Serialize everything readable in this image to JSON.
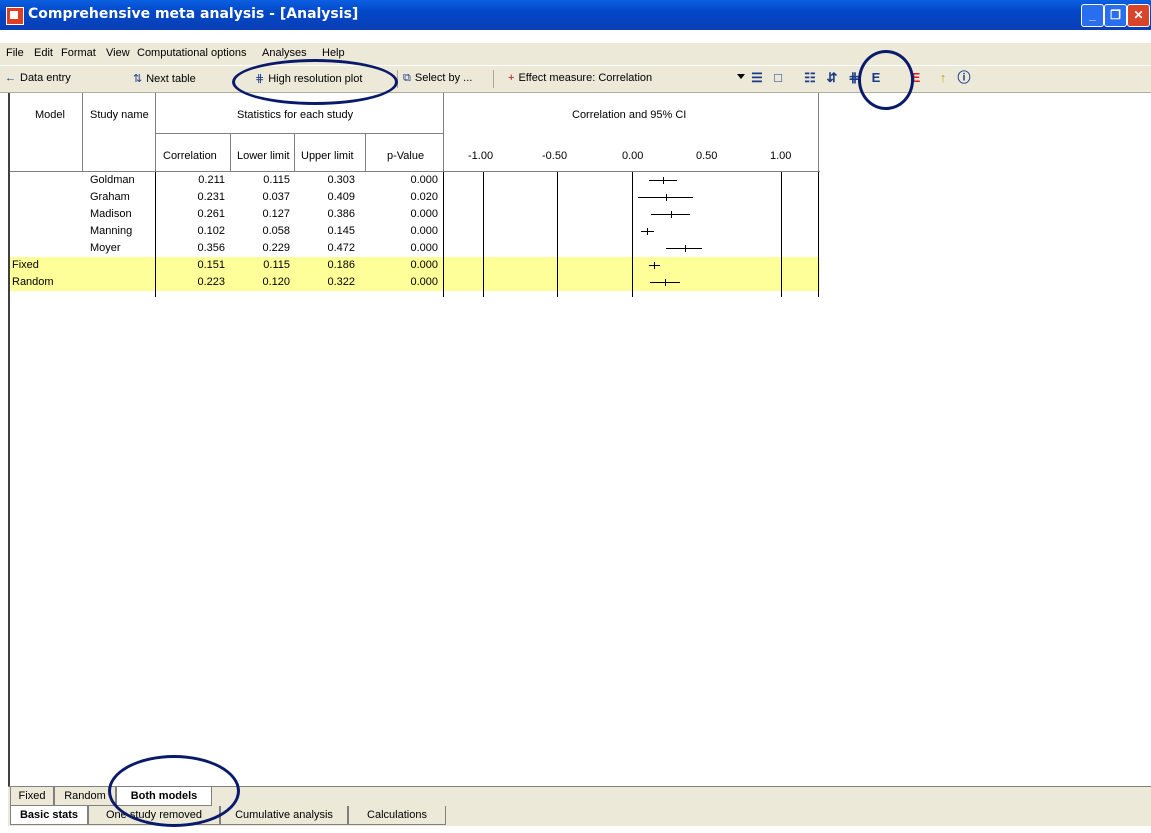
{
  "window": {
    "title": "Comprehensive meta analysis - [Analysis]"
  },
  "menu": [
    "File",
    "Edit",
    "Format",
    "View",
    "Computational options",
    "Analyses",
    "Help"
  ],
  "toolbar": {
    "data_entry": "Data entry",
    "next_table": "Next table",
    "high_res": "High resolution plot",
    "select_by": "Select by ...",
    "effect_measure": "Effect measure: Correlation"
  },
  "table": {
    "col_model": "Model",
    "col_study": "Study name",
    "group_stats": "Statistics for each study",
    "group_plot": "Correlation and 95% CI",
    "cols": [
      "Correlation",
      "Lower limit",
      "Upper limit",
      "p-Value"
    ],
    "axis_ticks": [
      "-1.00",
      "-0.50",
      "0.00",
      "0.50",
      "1.00"
    ],
    "rows": [
      {
        "model": "",
        "study": "Goldman",
        "corr": "0.211",
        "lower": "0.115",
        "upper": "0.303",
        "p": "0.000",
        "hl": false
      },
      {
        "model": "",
        "study": "Graham",
        "corr": "0.231",
        "lower": "0.037",
        "upper": "0.409",
        "p": "0.020",
        "hl": false
      },
      {
        "model": "",
        "study": "Madison",
        "corr": "0.261",
        "lower": "0.127",
        "upper": "0.386",
        "p": "0.000",
        "hl": false
      },
      {
        "model": "",
        "study": "Manning",
        "corr": "0.102",
        "lower": "0.058",
        "upper": "0.145",
        "p": "0.000",
        "hl": false
      },
      {
        "model": "",
        "study": "Moyer",
        "corr": "0.356",
        "lower": "0.229",
        "upper": "0.472",
        "p": "0.000",
        "hl": false
      },
      {
        "model": "Fixed",
        "study": "",
        "corr": "0.151",
        "lower": "0.115",
        "upper": "0.186",
        "p": "0.000",
        "hl": true
      },
      {
        "model": "Random",
        "study": "",
        "corr": "0.223",
        "lower": "0.120",
        "upper": "0.322",
        "p": "0.000",
        "hl": true
      }
    ]
  },
  "tabs_top": [
    "Fixed",
    "Random",
    "Both models"
  ],
  "tabs_bottom": [
    "Basic stats",
    "One study removed",
    "Cumulative analysis",
    "Calculations"
  ],
  "colors": {
    "highlight": "#ffff99",
    "annotation_ring": "#0a1a6a"
  }
}
